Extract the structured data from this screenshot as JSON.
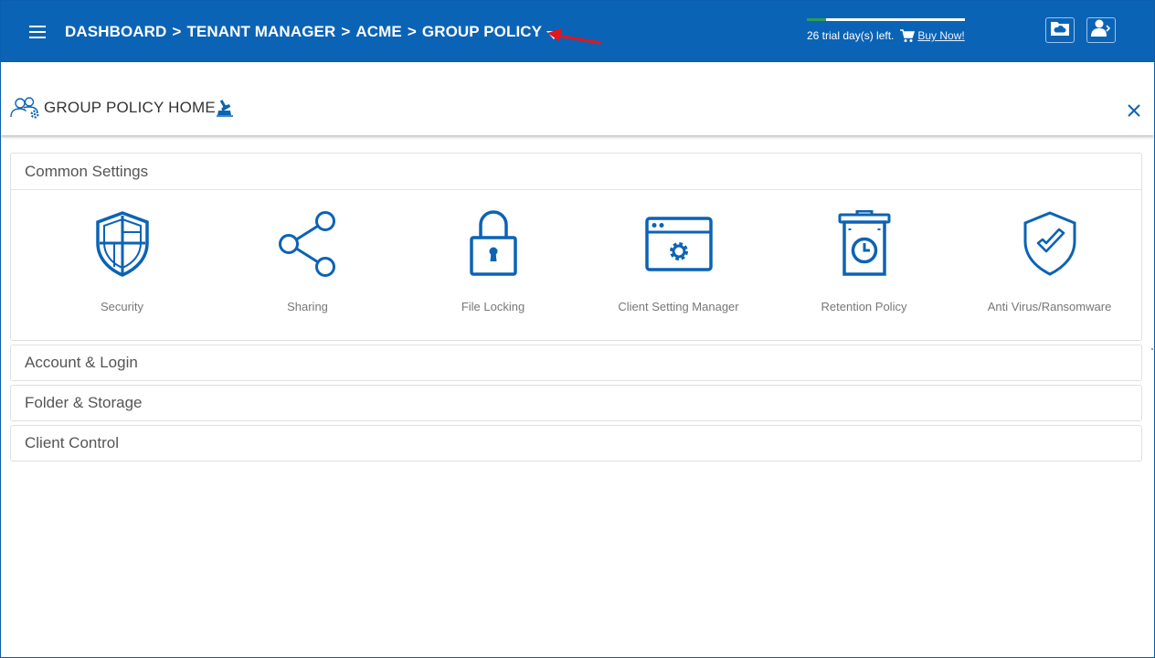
{
  "header": {
    "breadcrumb": [
      "DASHBOARD",
      "TENANT MANAGER",
      "ACME",
      "GROUP POLICY"
    ],
    "separator": ">",
    "trial_text": "26 trial day(s) left.",
    "buy_now": "Buy Now!",
    "trial_progress_percent": 12,
    "colors": {
      "bar": "#0b63b5",
      "progress": "#2e9e56",
      "annotation_arrow": "#e8141c"
    },
    "icons": [
      "menu-icon",
      "caret-down-icon",
      "cart-icon",
      "cloud-folder-icon",
      "user-switch-icon"
    ]
  },
  "page": {
    "title": "GROUP POLICY HOME",
    "icons": [
      "group-settings-icon",
      "clean-icon",
      "close-icon"
    ]
  },
  "sections": [
    {
      "title": "Common Settings",
      "expanded": true,
      "items": [
        {
          "label": "Security",
          "icon": "security-shield-icon"
        },
        {
          "label": "Sharing",
          "icon": "share-icon"
        },
        {
          "label": "File Locking",
          "icon": "lock-icon"
        },
        {
          "label": "Client Setting Manager",
          "icon": "browser-gear-icon"
        },
        {
          "label": "Retention Policy",
          "icon": "trash-clock-icon"
        },
        {
          "label": "Anti Virus/Ransomware",
          "icon": "shield-check-icon"
        }
      ]
    },
    {
      "title": "Account & Login",
      "expanded": false
    },
    {
      "title": "Folder & Storage",
      "expanded": false
    },
    {
      "title": "Client Control",
      "expanded": false
    }
  ],
  "accent_color": "#0b63b5"
}
